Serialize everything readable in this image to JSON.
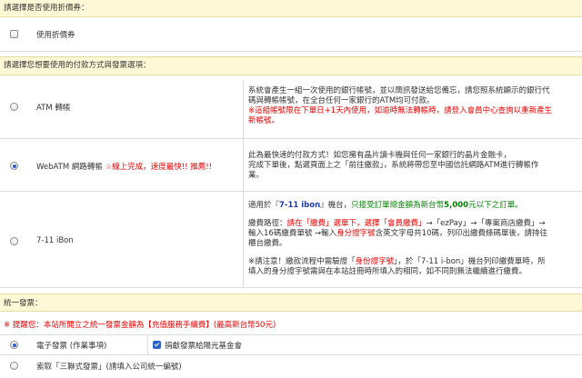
{
  "coupon": {
    "header": "請選擇是否使用折價券：",
    "option_label": "使用折價券"
  },
  "payment": {
    "header": "請選擇您想要使用的付款方式與發票選項：",
    "atm": {
      "label": "ATM 轉帳",
      "desc_line1": "系統會產生一組一次使用的銀行帳號，並以簡訊發送給您備忘，請您照系統顯示的銀行代",
      "desc_line2": "碼與轉帳帳號，在全台任何一家銀行的ATM均可付款。",
      "warn_line1": "※這組帳號限在下單日+1天內使用，如逾時無法轉帳時，請登入會員中心查詢以重新產生",
      "warn_line2": "新帳號。"
    },
    "webatm": {
      "label": "WebATM 網路轉帳",
      "badge": "☆線上完成，速度最快!! 推薦!!",
      "desc_line1": "此為最快速的付款方式！如您擁有晶片讀卡機與任何一家銀行的晶片金融卡，",
      "desc_line2": "完成下單後，點選頁面上之「前往繳款」，系統將帶您至中國信託網路ATM進行轉帳作",
      "desc_line3": "業。"
    },
    "ibon": {
      "label": "7-11 iBon",
      "p1_a": "適用於『",
      "p1_brand": "7-11 ibon",
      "p1_b": "』機台，",
      "p1_c": "只接受訂單總金額為新台幣",
      "p1_amount": "5,000",
      "p1_d": "元以下之訂單。",
      "p2_a": "繳費路徑：",
      "p2_b": "請在「繳費」選單下，選擇「會員繳費」",
      "p2_c": "→「ezPay」→「專案商店繳費」→",
      "p2_line2_a": "輸入16碼繳費單號 →輸入",
      "p2_line2_b": "身分證字號",
      "p2_line2_c": "含英文字母共10碼，列印出繳費條碼單後，請持往",
      "p2_line3": "櫃台繳費。",
      "p3_a": "※請注意！繳款流程中需驗證「",
      "p3_b": "身份證字號",
      "p3_c": "」，於「7-11 i-bon」機台列印繳費單時，所",
      "p3_line2": "填入的身分證字號需與在本站註冊時所填入的相同，如不同則無法繼續進行繳費。"
    }
  },
  "invoice": {
    "header": "統一發票：",
    "notice": "※ 提醒您：本站所開立之統一發票金額為【充值服務手續費】(最高新台幣50元)",
    "electronic_label": "電子發票 (作業事項)",
    "donate_label": "捐獻發票給陽光基金會",
    "triplicate_label": "索取「三聯式發票」(請填入公司統一編號)"
  },
  "colors": {
    "header_bg": "#fff8d6",
    "accent_red": "#e60000",
    "brand_blue": "#1a3bb8",
    "green": "#008000",
    "radio_selected": "#2b63c6"
  }
}
